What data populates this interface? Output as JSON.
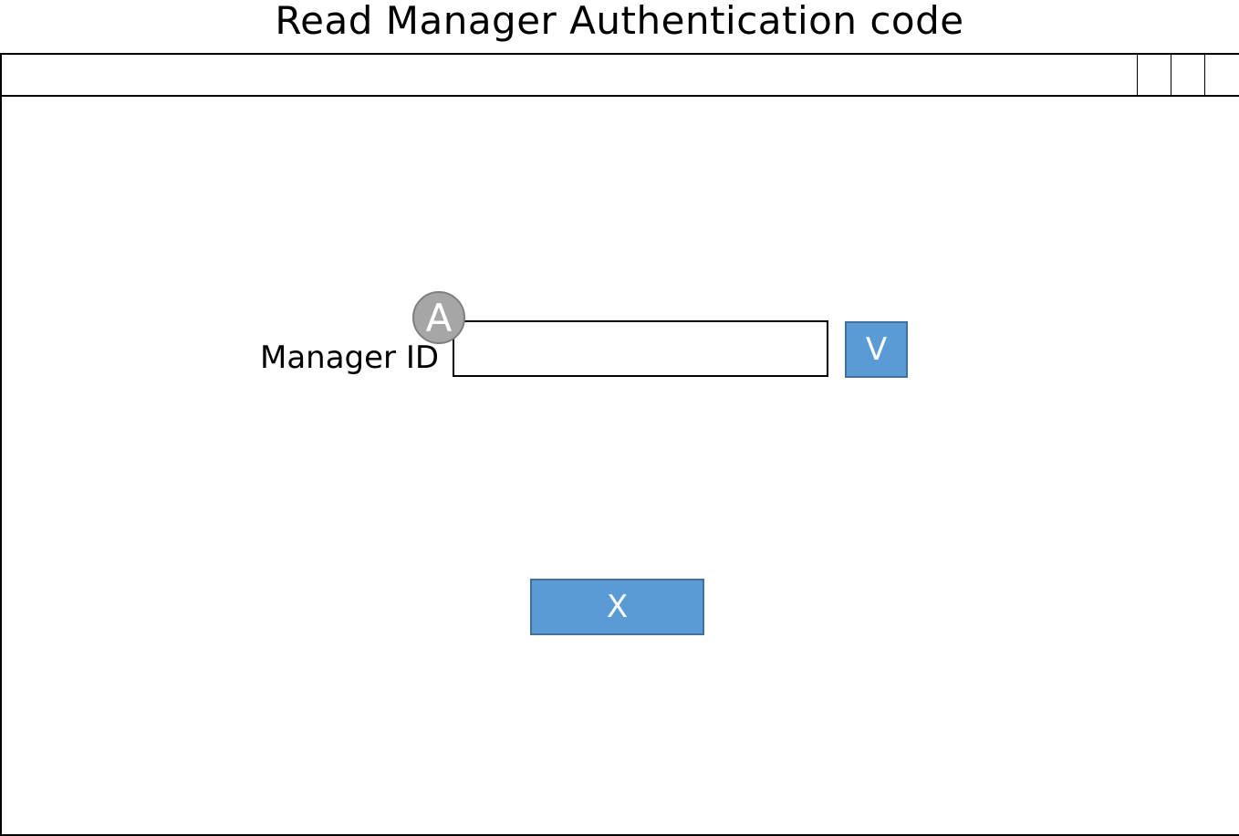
{
  "page": {
    "title": "Read Manager Authentication code"
  },
  "window": {
    "controls": [
      "",
      "",
      ""
    ]
  },
  "form": {
    "manager_id_label": "Manager ID",
    "manager_id_value": "",
    "annotation_marker": "A",
    "verify_label": "V",
    "close_label": "X"
  },
  "colors": {
    "button_fill": "#5b9bd5",
    "button_border": "#41719c",
    "marker_fill": "#a6a6a6"
  }
}
